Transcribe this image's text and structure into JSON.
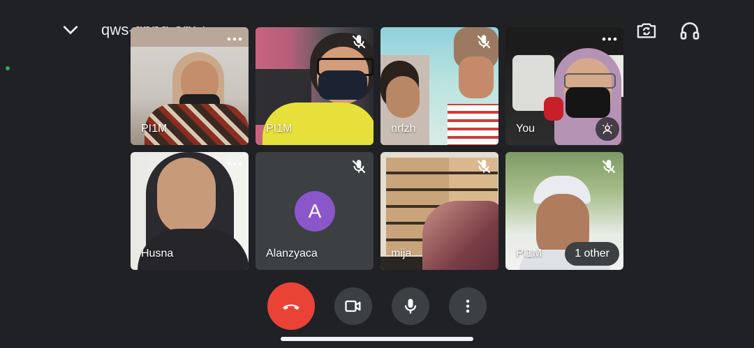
{
  "header": {
    "meeting_code": "qws-qppg-erx"
  },
  "tiles": [
    {
      "name": "PI1M",
      "muted": false
    },
    {
      "name": "PI1M",
      "muted": true
    },
    {
      "name": "nrfzh",
      "muted": true
    },
    {
      "name": "You",
      "muted": false
    },
    {
      "name": "Husna",
      "muted": false
    },
    {
      "name": "Alanzyaca",
      "muted": true,
      "avatar_letter": "A"
    },
    {
      "name": "mija",
      "muted": true
    },
    {
      "name": "PI1M",
      "muted": true,
      "extra": "1 other"
    }
  ],
  "colors": {
    "background": "#202124",
    "end_call": "#ea4335",
    "control": "#3c4043",
    "avatar": "#8a56c9"
  }
}
